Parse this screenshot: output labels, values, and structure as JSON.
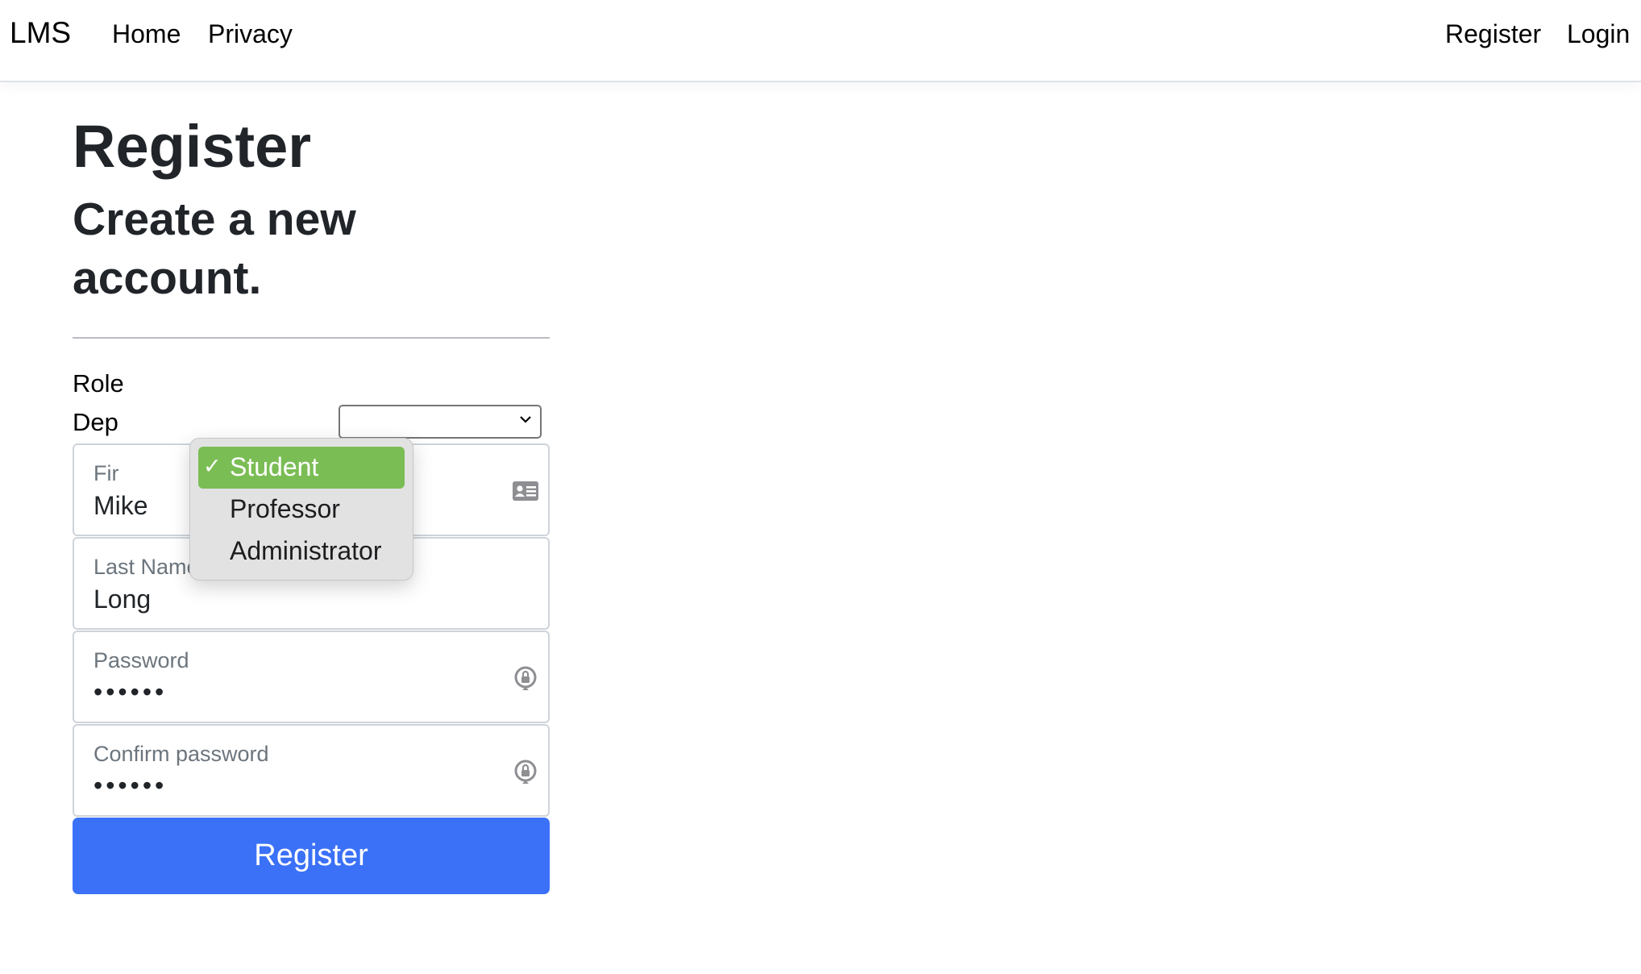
{
  "nav": {
    "brand": "LMS",
    "links": [
      "Home",
      "Privacy"
    ],
    "right_links": [
      "Register",
      "Login"
    ]
  },
  "page": {
    "title": "Register",
    "subtitle": "Create a new account."
  },
  "form": {
    "role_label": "Role",
    "department_label": "Dep",
    "first_name": {
      "label": "Fir",
      "value": "Mike",
      "icon": "contact-card-icon"
    },
    "last_name": {
      "label": "Last Name",
      "value": "Long"
    },
    "password": {
      "label": "Password",
      "value": "••••••",
      "icon": "password-key-icon"
    },
    "confirm_password": {
      "label": "Confirm password",
      "value": "••••••",
      "icon": "password-key-icon"
    },
    "submit_label": "Register"
  },
  "role_dropdown": {
    "options": [
      "Student",
      "Professor",
      "Administrator"
    ],
    "selected": "Student",
    "selected_color": "#7bbd55"
  },
  "colors": {
    "primary": "#3b71f7",
    "text": "#212529"
  }
}
